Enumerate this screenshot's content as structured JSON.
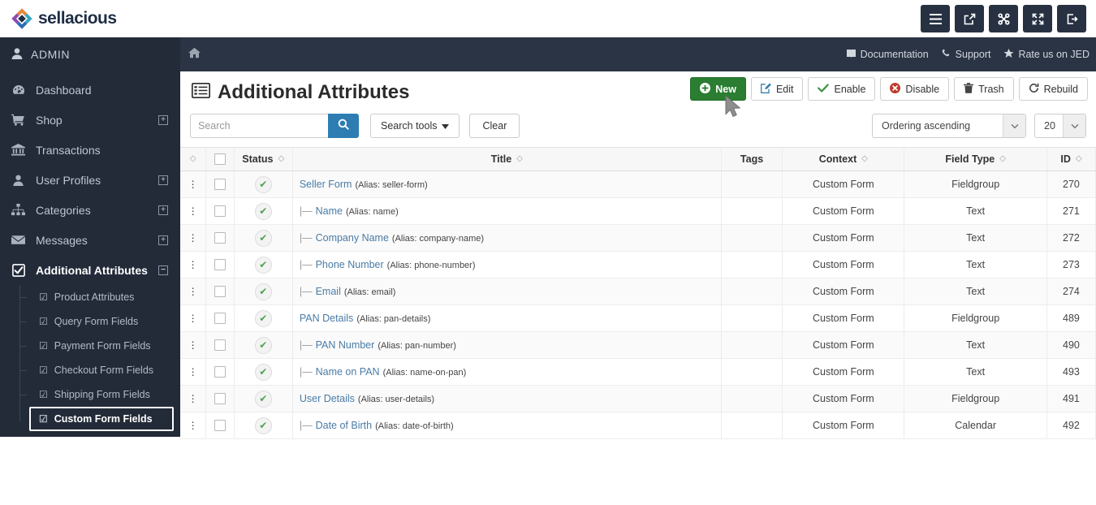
{
  "brand": {
    "name": "sellacious",
    "logo_icon": "sellacious-diamond-logo"
  },
  "topbar": {
    "buttons": [
      {
        "name": "menu-toggle-button",
        "icon": "hamburger-icon"
      },
      {
        "name": "preview-site-button",
        "icon": "external-link-icon"
      },
      {
        "name": "joomla-admin-button",
        "icon": "joomla-logo-icon"
      },
      {
        "name": "fullscreen-button",
        "icon": "expand-arrows-icon"
      },
      {
        "name": "logout-button",
        "icon": "sign-out-icon"
      }
    ]
  },
  "adminbar": {
    "user_label": "ADMIN",
    "user_icon": "user-icon",
    "home_icon": "home-icon",
    "links": [
      {
        "label": "Documentation",
        "icon": "book-icon"
      },
      {
        "label": "Support",
        "icon": "phone-icon"
      },
      {
        "label": "Rate us on JED",
        "icon": "star-icon"
      }
    ]
  },
  "sidebar": {
    "items": [
      {
        "label": "Dashboard",
        "icon": "dashboard-icon",
        "expandable": false
      },
      {
        "label": "Shop",
        "icon": "cart-icon",
        "expandable": true,
        "toggle": "+"
      },
      {
        "label": "Transactions",
        "icon": "bank-icon",
        "expandable": false
      },
      {
        "label": "User Profiles",
        "icon": "user-icon",
        "expandable": true,
        "toggle": "+"
      },
      {
        "label": "Categories",
        "icon": "sitemap-icon",
        "expandable": true,
        "toggle": "+"
      },
      {
        "label": "Messages",
        "icon": "envelope-icon",
        "expandable": true,
        "toggle": "+"
      },
      {
        "label": "Additional Attributes",
        "icon": "checkbox-icon",
        "expandable": true,
        "toggle": "−",
        "active": true
      }
    ],
    "submenu": [
      {
        "label": "Product Attributes",
        "icon": "check-square-icon",
        "selected": false
      },
      {
        "label": "Query Form Fields",
        "icon": "check-square-icon",
        "selected": false
      },
      {
        "label": "Payment Form Fields",
        "icon": "check-square-icon",
        "selected": false
      },
      {
        "label": "Checkout Form Fields",
        "icon": "check-square-icon",
        "selected": false
      },
      {
        "label": "Shipping Form Fields",
        "icon": "check-square-icon",
        "selected": false
      },
      {
        "label": "Custom Form Fields",
        "icon": "check-square-icon",
        "selected": true
      }
    ]
  },
  "page": {
    "title": "Additional Attributes",
    "title_icon": "list-icon"
  },
  "toolbar": {
    "buttons": [
      {
        "label": "New",
        "icon": "plus-circle-icon",
        "style": "primary"
      },
      {
        "label": "Edit",
        "icon": "pencil-square-icon",
        "style": "default"
      },
      {
        "label": "Enable",
        "icon": "check-icon",
        "style": "default"
      },
      {
        "label": "Disable",
        "icon": "times-circle-icon",
        "style": "default"
      },
      {
        "label": "Trash",
        "icon": "trash-icon",
        "style": "default"
      },
      {
        "label": "Rebuild",
        "icon": "refresh-icon",
        "style": "default"
      }
    ]
  },
  "filters": {
    "search_placeholder": "Search",
    "search_value": "",
    "search_icon": "search-icon",
    "search_tools_label": "Search tools",
    "search_tools_icon": "caret-down-icon",
    "clear_label": "Clear",
    "ordering_value": "Ordering ascending",
    "limit_value": "20",
    "select_icon": "chevron-down-icon"
  },
  "table": {
    "sort_icon": "sort-icon",
    "grip_icon": "drag-handle-icon",
    "status_icon": "check-circle-icon",
    "columns": [
      {
        "key": "handle",
        "label": "",
        "sortable": true
      },
      {
        "key": "check",
        "label": "",
        "sortable": false
      },
      {
        "key": "status",
        "label": "Status",
        "sortable": true
      },
      {
        "key": "title",
        "label": "Title",
        "sortable": true
      },
      {
        "key": "tags",
        "label": "Tags",
        "sortable": false
      },
      {
        "key": "context",
        "label": "Context",
        "sortable": true
      },
      {
        "key": "ftype",
        "label": "Field Type",
        "sortable": true
      },
      {
        "key": "id",
        "label": "ID",
        "sortable": true
      }
    ],
    "rows": [
      {
        "indent": false,
        "title": "Seller Form",
        "alias": "(Alias: seller-form)",
        "tags": "",
        "context": "Custom Form",
        "ftype": "Fieldgroup",
        "id": "270"
      },
      {
        "indent": true,
        "title": "Name",
        "alias": "(Alias: name)",
        "tags": "",
        "context": "Custom Form",
        "ftype": "Text",
        "id": "271"
      },
      {
        "indent": true,
        "title": "Company Name",
        "alias": "(Alias: company-name)",
        "tags": "",
        "context": "Custom Form",
        "ftype": "Text",
        "id": "272"
      },
      {
        "indent": true,
        "title": "Phone Number",
        "alias": "(Alias: phone-number)",
        "tags": "",
        "context": "Custom Form",
        "ftype": "Text",
        "id": "273"
      },
      {
        "indent": true,
        "title": "Email",
        "alias": "(Alias: email)",
        "tags": "",
        "context": "Custom Form",
        "ftype": "Text",
        "id": "274"
      },
      {
        "indent": false,
        "title": "PAN Details",
        "alias": "(Alias: pan-details)",
        "tags": "",
        "context": "Custom Form",
        "ftype": "Fieldgroup",
        "id": "489"
      },
      {
        "indent": true,
        "title": "PAN Number",
        "alias": "(Alias: pan-number)",
        "tags": "",
        "context": "Custom Form",
        "ftype": "Text",
        "id": "490"
      },
      {
        "indent": true,
        "title": "Name on PAN",
        "alias": "(Alias: name-on-pan)",
        "tags": "",
        "context": "Custom Form",
        "ftype": "Text",
        "id": "493"
      },
      {
        "indent": false,
        "title": "User Details",
        "alias": "(Alias: user-details)",
        "tags": "",
        "context": "Custom Form",
        "ftype": "Fieldgroup",
        "id": "491"
      },
      {
        "indent": true,
        "title": "Date of Birth",
        "alias": "(Alias: date-of-birth)",
        "tags": "",
        "context": "Custom Form",
        "ftype": "Calendar",
        "id": "492"
      }
    ]
  },
  "colors": {
    "sidebar_bg": "#232b39",
    "adminbar_bg": "#2b3444",
    "primary_green": "#2a7d31",
    "search_blue": "#2d7db3",
    "link_blue": "#4a7ba6",
    "status_green": "#4ea24e"
  }
}
